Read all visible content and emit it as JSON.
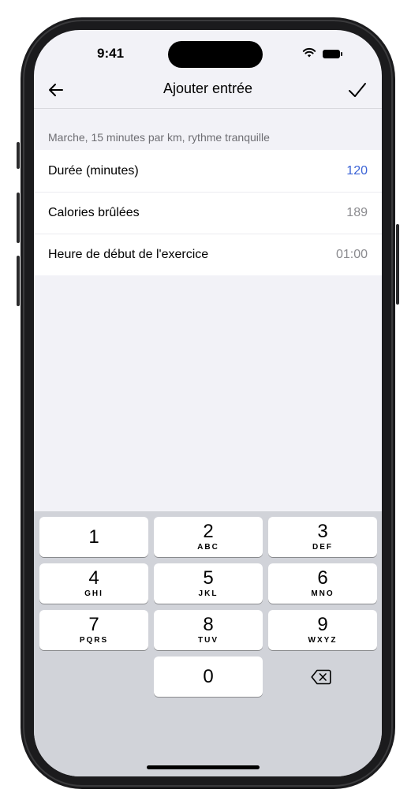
{
  "status_bar": {
    "time": "9:41",
    "wifi_icon": "wifi-icon",
    "battery_icon": "battery-icon"
  },
  "nav": {
    "title": "Ajouter entrée",
    "back_icon": "arrow-left-icon",
    "done_icon": "checkmark-icon"
  },
  "section": {
    "header": "Marche, 15 minutes par km, rythme tranquille",
    "rows": [
      {
        "label": "Durée (minutes)",
        "value": "120",
        "active": true
      },
      {
        "label": "Calories brûlées",
        "value": "189",
        "active": false
      },
      {
        "label": "Heure de début de l'exercice",
        "value": "01:00",
        "active": false
      }
    ]
  },
  "keyboard": {
    "keys": [
      {
        "num": "1",
        "letters": ""
      },
      {
        "num": "2",
        "letters": "ABC"
      },
      {
        "num": "3",
        "letters": "DEF"
      },
      {
        "num": "4",
        "letters": "GHI"
      },
      {
        "num": "5",
        "letters": "JKL"
      },
      {
        "num": "6",
        "letters": "MNO"
      },
      {
        "num": "7",
        "letters": "PQRS"
      },
      {
        "num": "8",
        "letters": "TUV"
      },
      {
        "num": "9",
        "letters": "WXYZ"
      },
      {
        "num": "0",
        "letters": ""
      }
    ],
    "delete_icon": "delete-backspace-icon"
  },
  "colors": {
    "accent": "#3b63d6",
    "background": "#f2f2f7",
    "keyboard_bg": "#d1d3d9"
  }
}
